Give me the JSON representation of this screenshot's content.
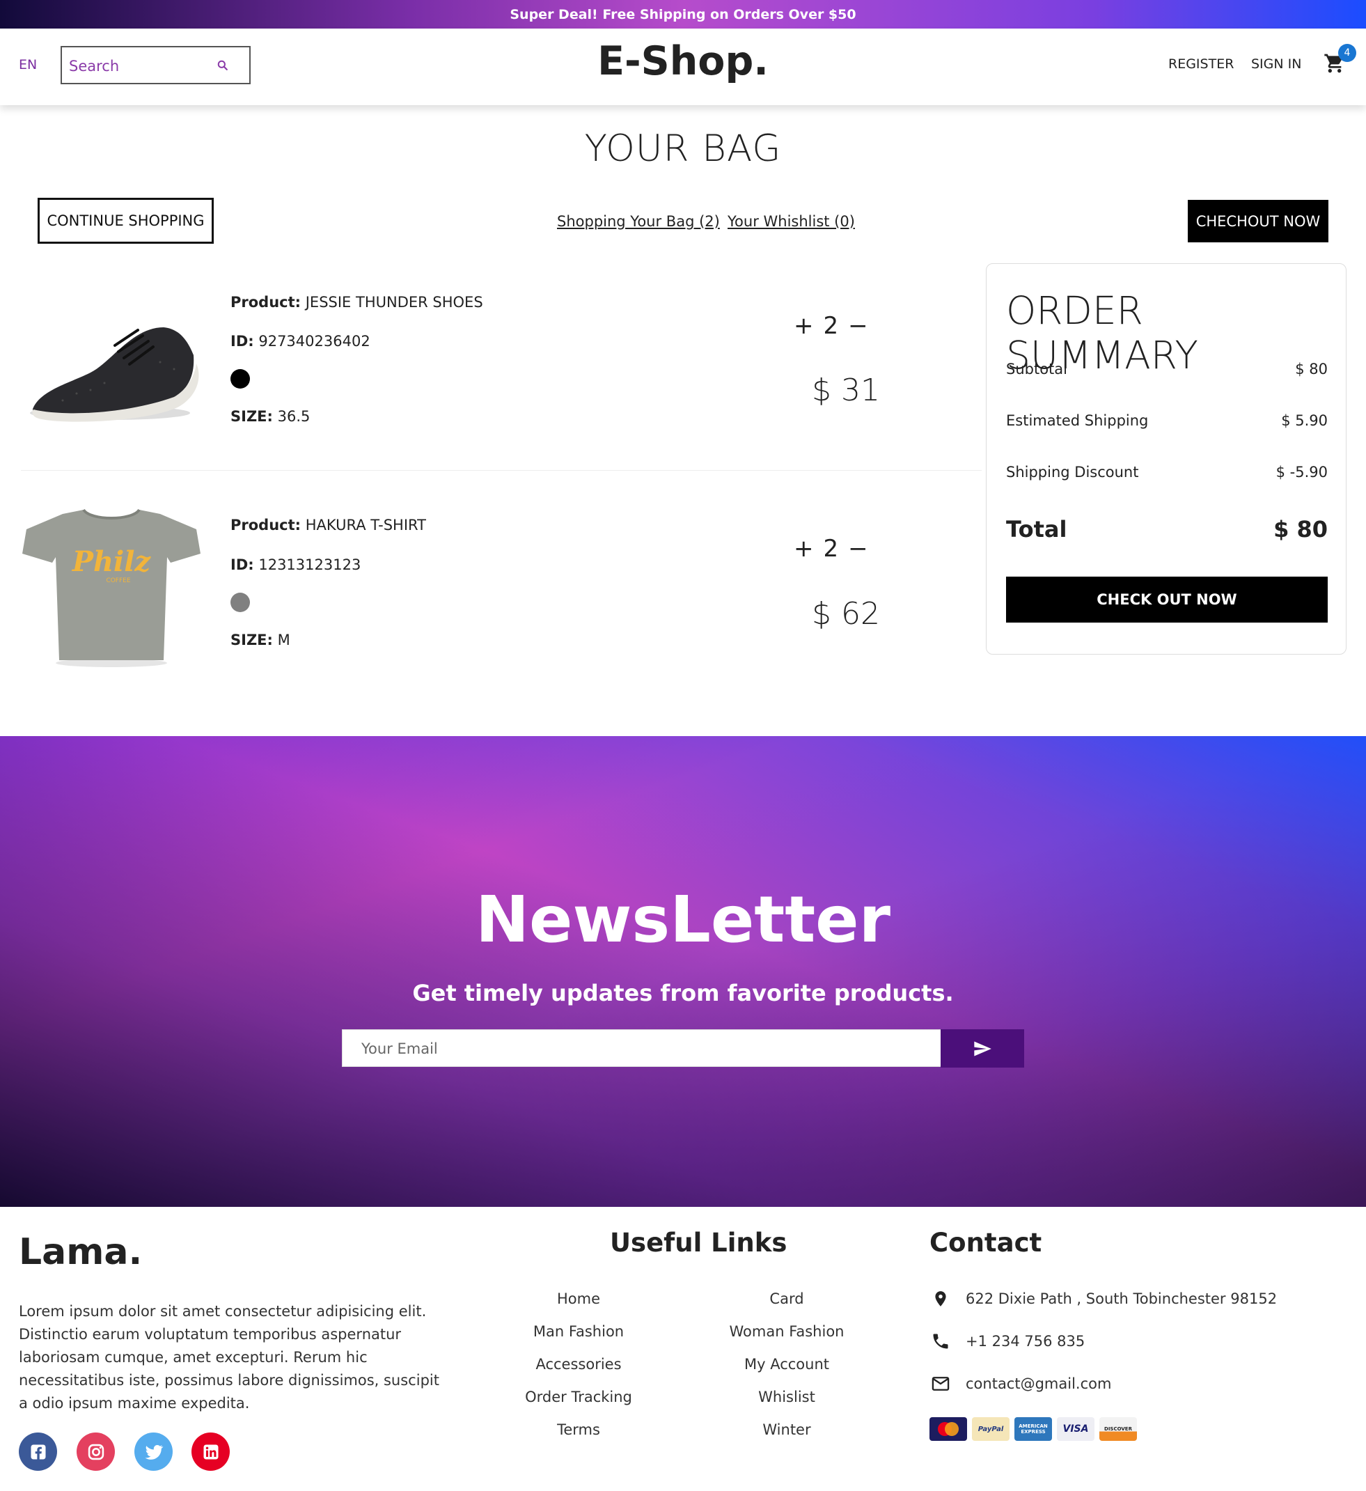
{
  "announcement": "Super Deal! Free Shipping on Orders Over $50",
  "nav": {
    "lang": "EN",
    "search_placeholder": "Search",
    "logo": "E-Shop.",
    "register": "REGISTER",
    "sign_in": "SIGN IN",
    "cart_count": "4"
  },
  "bag": {
    "title": "YOUR BAG",
    "continue_label": "CONTINUE SHOPPING",
    "bag_link": "Shopping Your Bag (2)",
    "wishlist_link": "Your Whishlist (0)",
    "checkout_top_label": "CHECHOUT NOW"
  },
  "products": [
    {
      "product_label": "Product:",
      "name": "JESSIE THUNDER SHOES",
      "id_label": "ID:",
      "id": "927340236402",
      "color": "#000000",
      "size_label": "SIZE:",
      "size": "36.5",
      "plus": "+",
      "quantity": "2",
      "minus": "−",
      "price": "$ 31"
    },
    {
      "product_label": "Product:",
      "name": "HAKURA T-SHIRT",
      "id_label": "ID:",
      "id": "12313123123",
      "color": "#808080",
      "size_label": "SIZE:",
      "size": "M",
      "plus": "+",
      "quantity": "2",
      "minus": "−",
      "price": "$ 62"
    }
  ],
  "summary": {
    "title": "ORDER SUMMARY",
    "rows": [
      {
        "label": "Subtotal",
        "value": "$ 80"
      },
      {
        "label": "Estimated Shipping",
        "value": "$ 5.90"
      },
      {
        "label": "Shipping Discount",
        "value": "$ -5.90"
      }
    ],
    "total_label": "Total",
    "total_value": "$ 80",
    "button": "CHECK OUT NOW"
  },
  "newsletter": {
    "title": "NewsLetter",
    "subtitle": "Get timely updates from favorite products.",
    "placeholder": "Your Email"
  },
  "footer": {
    "logo": "Lama.",
    "description": "Lorem ipsum dolor sit amet consectetur adipisicing elit. Distinctio earum voluptatum temporibus aspernatur laboriosam cumque, amet excepturi. Rerum hic necessitatibus iste, possimus labore dignissimos, suscipit a odio ipsum maxime expedita.",
    "social": [
      "facebook-icon",
      "instagram-icon",
      "twitter-icon",
      "linkedin-icon"
    ],
    "links_title": "Useful Links",
    "links_left": [
      "Home",
      "Man Fashion",
      "Accessories",
      "Order Tracking",
      "Terms"
    ],
    "links_right": [
      "Card",
      "Woman Fashion",
      "My Account",
      "Whislist",
      "Winter"
    ],
    "contact_title": "Contact",
    "address": "622 Dixie Path , South Tobinchester 98152",
    "phone": "+1 234 756 835",
    "email": "contact@gmail.com",
    "payments": [
      "MasterCard",
      "PayPal",
      "AMERICAN EXPRESS",
      "VISA",
      "DISCOVER"
    ]
  },
  "colors": {
    "accent": "#7b2fa0",
    "badge": "#1976d2",
    "send_button": "#4b0f7a"
  }
}
